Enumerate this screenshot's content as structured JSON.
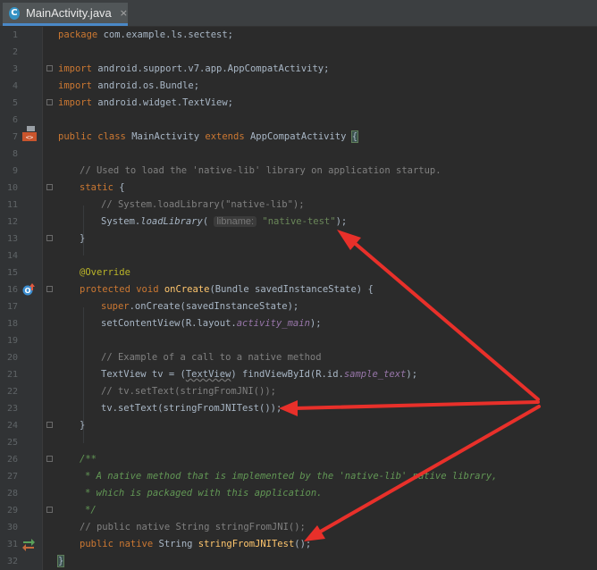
{
  "tab": {
    "icon": "java-class-icon",
    "icon_letter": "C",
    "title": "MainActivity.java",
    "close": "×"
  },
  "code": {
    "l1": [
      "package",
      "com.example.ls.sectest;"
    ],
    "l3": [
      "import",
      "android.support.v7.app.AppCompatActivity;"
    ],
    "l4": [
      "import",
      "android.os.Bundle;"
    ],
    "l5": [
      "import",
      "android.widget.TextView;"
    ],
    "l7": [
      "public",
      "class",
      "MainActivity",
      "extends",
      "AppCompatActivity",
      "{"
    ],
    "l9": "// Used to load the 'native-lib' library on application startup.",
    "l10": [
      "static",
      "{"
    ],
    "l11": "// System.loadLibrary(\"native-lib\");",
    "l12": [
      "System.",
      "loadLibrary",
      "(",
      "libname:",
      "\"native-test\"",
      ");"
    ],
    "l13": "}",
    "l15": "@Override",
    "l16": [
      "protected",
      "void",
      "onCreate",
      "(Bundle savedInstanceState) {"
    ],
    "l17": [
      "super",
      ".onCreate(savedInstanceState);"
    ],
    "l18": [
      "setContentView(R.layout.",
      "activity_main",
      ");"
    ],
    "l20": "// Example of a call to a native method",
    "l21": [
      "TextView tv = (",
      "TextView",
      ") findViewById(R.id.",
      "sample_text",
      ");"
    ],
    "l22": "// tv.setText(stringFromJNI());",
    "l23": "tv.setText(stringFromJNITest());",
    "l24": "}",
    "l26": "/**",
    "l27": "* A native method that is implemented by the 'native-lib' native library,",
    "l28": "* which is packaged with this application.",
    "l29": "*/",
    "l30": "// public native String stringFromJNI();",
    "l31": [
      "public",
      "native",
      "String",
      "stringFromJNITest",
      "();"
    ],
    "l32": "}"
  },
  "line_numbers": [
    "1",
    "2",
    "3",
    "4",
    "5",
    "6",
    "7",
    "8",
    "9",
    "10",
    "11",
    "12",
    "13",
    "14",
    "15",
    "16",
    "17",
    "18",
    "19",
    "20",
    "21",
    "22",
    "23",
    "24",
    "25",
    "26",
    "27",
    "28",
    "29",
    "30",
    "31",
    "32"
  ],
  "annotation_color": "#e8302a"
}
